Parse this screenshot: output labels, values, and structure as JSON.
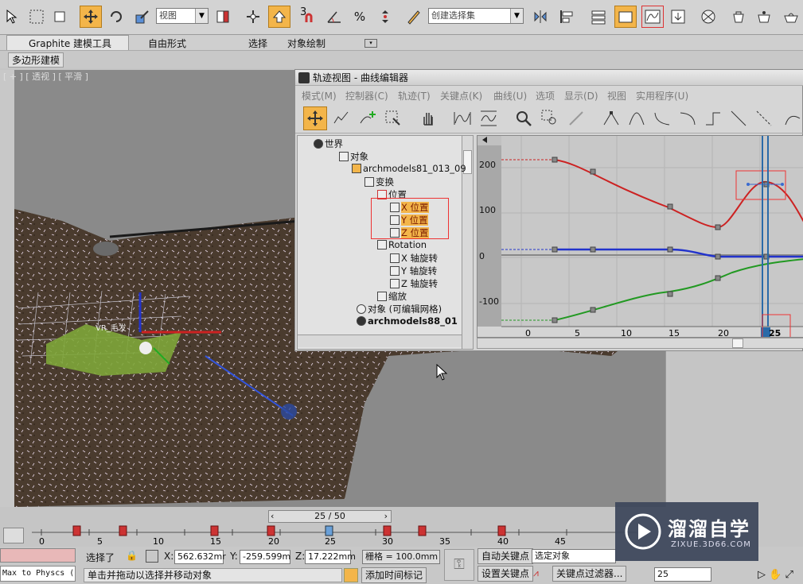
{
  "toolbar": {
    "view_dropdown": "视图",
    "selection_set": "创建选择集",
    "snap_3": "3"
  },
  "ribbon": {
    "tabs": [
      "Graphite 建模工具",
      "自由形式",
      "选择",
      "对象绘制"
    ],
    "subtab": "多边形建模"
  },
  "viewport": {
    "label": "[ + ] [ 透视 ] [ 平滑 ]",
    "object_label": "VR_毛发"
  },
  "track_view": {
    "title": "轨迹视图 - 曲线编辑器",
    "menu": [
      "模式(M)",
      "控制器(C)",
      "轨迹(T)",
      "关键点(K)",
      "曲线(U)",
      "选项",
      "显示(D)",
      "视图",
      "实用程序(U)"
    ],
    "tree": [
      {
        "label": "世界",
        "highlight": false
      },
      {
        "label": "对象",
        "highlight": false
      },
      {
        "label": "archmodels81_013_09",
        "highlight": false
      },
      {
        "label": "变换",
        "highlight": false
      },
      {
        "label": "位置",
        "highlight": false
      },
      {
        "label": "X 位置",
        "highlight": true
      },
      {
        "label": "Y 位置",
        "highlight": true
      },
      {
        "label": "Z 位置",
        "highlight": true
      },
      {
        "label": "Rotation",
        "highlight": false
      },
      {
        "label": "X 轴旋转",
        "highlight": false
      },
      {
        "label": "Y 轴旋转",
        "highlight": false
      },
      {
        "label": "Z 轴旋转",
        "highlight": false
      },
      {
        "label": "缩放",
        "highlight": false
      },
      {
        "label": "对象 (可编辑网格)",
        "highlight": false
      },
      {
        "label": "archmodels88_01",
        "highlight": false
      }
    ],
    "y_ticks": [
      "200",
      "100",
      "0",
      "-100"
    ],
    "x_ticks": [
      "0",
      "5",
      "10",
      "15",
      "20",
      "25"
    ]
  },
  "timeline": {
    "frame": "25 / 50",
    "ticks": [
      "0",
      "5",
      "10",
      "15",
      "20",
      "25",
      "30",
      "35",
      "40",
      "45"
    ]
  },
  "status": {
    "selected": "选择了",
    "x_label": "X:",
    "x_value": "562.632mr",
    "y_label": "Y:",
    "y_value": "-259.599m",
    "z_label": "Z:",
    "z_value": "17.222mm",
    "grid": "栅格 = 100.0mm",
    "auto_key": "自动关键点",
    "set_key": "设置关键点",
    "selected_obj": "选定对象",
    "key_filter": "关键点过滤器...",
    "frame": "25",
    "left_text": "Max to Physcs (",
    "prompt": "单击并拖动以选择并移动对象",
    "add_tag": "添加时间标记"
  },
  "watermark": {
    "title": "溜溜自学",
    "url": "ZIXUE.3D66.COM"
  }
}
